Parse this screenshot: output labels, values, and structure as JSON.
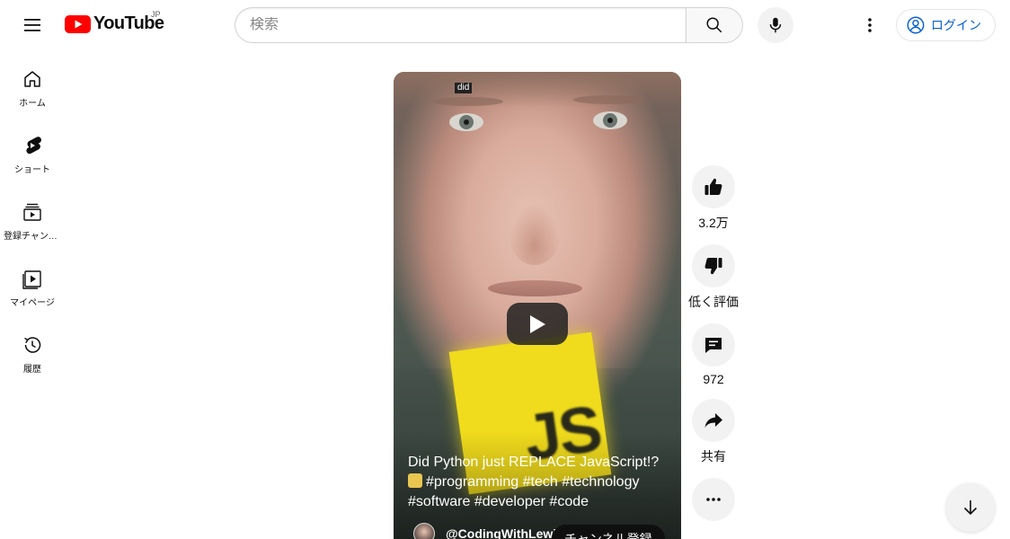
{
  "header": {
    "logo_text": "YouTube",
    "logo_country": "JP",
    "search_placeholder": "検索",
    "login_label": "ログイン"
  },
  "sidebar": {
    "items": [
      {
        "label": "ホーム",
        "icon": "home-icon"
      },
      {
        "label": "ショート",
        "icon": "shorts-icon"
      },
      {
        "label": "登録チャンネル",
        "icon": "subscriptions-icon"
      },
      {
        "label": "マイページ",
        "icon": "you-icon"
      },
      {
        "label": "履歴",
        "icon": "history-icon"
      }
    ]
  },
  "video": {
    "caption_word": "did",
    "title": "Did Python just REPLACE JavaScript!? 🤷 #programming #tech #technology #software #developer #code",
    "title_line1": "Did Python just REPLACE JavaScript!?",
    "title_line2": "#programming #tech #technology",
    "title_line3": "#software #developer #code",
    "channel": "@CodingWithLewis",
    "subscribe_label": "チャンネル登録",
    "overlay_text": "JS"
  },
  "actions": {
    "like_count": "3.2万",
    "dislike_label": "低く評価",
    "comment_count": "972",
    "share_label": "共有"
  },
  "colors": {
    "brand_red": "#ff0000",
    "link_blue": "#065fd4",
    "js_yellow": "#f0db1c"
  }
}
